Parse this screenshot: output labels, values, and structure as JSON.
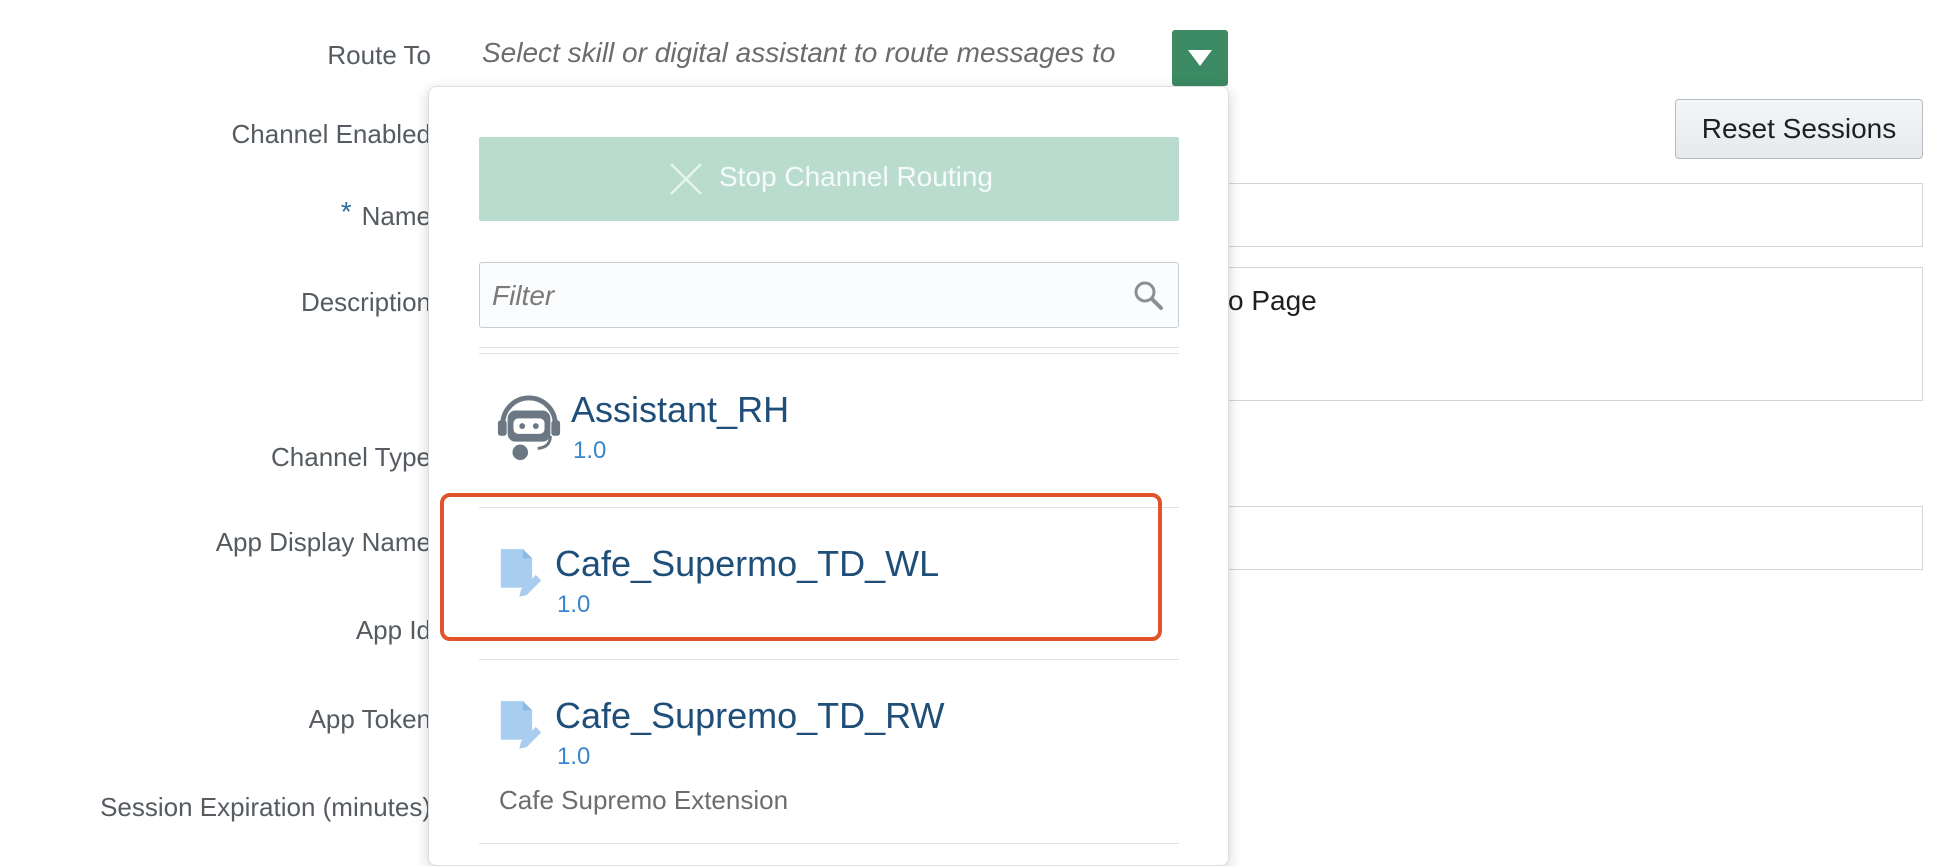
{
  "form": {
    "labels": {
      "route_to": "Route To",
      "channel_enabled": "Channel Enabled",
      "name": "Name",
      "name_required_marker": "*",
      "description": "Description",
      "channel_type": "Channel Type",
      "app_display_name": "App Display Name",
      "app_id": "App Id",
      "app_token": "App Token",
      "session_expiration": "Session Expiration (minutes)"
    },
    "route_to_placeholder": "Select skill or digital assistant to route messages to",
    "description_partial_text": "o Page",
    "reset_sessions_label": "Reset Sessions"
  },
  "dropdown": {
    "stop_routing_label": "Stop Channel Routing",
    "filter_placeholder": "Filter",
    "items": [
      {
        "name": "Assistant_RH",
        "version": "1.0",
        "icon": "robot-assistant-icon"
      },
      {
        "name": "Cafe_Supermo_TD_WL",
        "version": "1.0",
        "icon": "skill-document-icon"
      },
      {
        "name": "Cafe_Supremo_TD_RW",
        "version": "1.0",
        "icon": "skill-document-icon",
        "description": "Cafe Supremo Extension"
      }
    ]
  },
  "colors": {
    "accent_green": "#3b8a63",
    "stop_button_bg": "#b9dccf",
    "highlight_border": "#e1542b",
    "item_title": "#1f4e79",
    "item_version": "#3a86cc"
  }
}
